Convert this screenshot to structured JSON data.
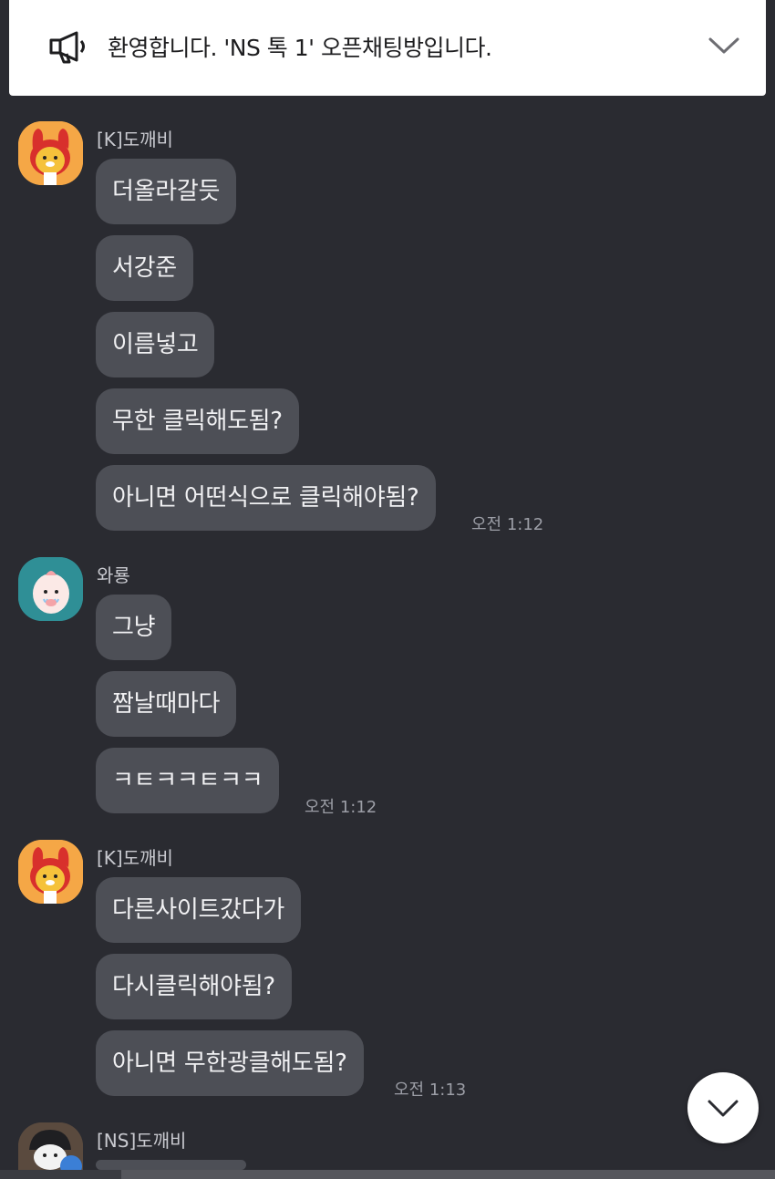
{
  "notice": {
    "text": "환영합니다. 'NS 톡 1' 오픈채팅방입니다.",
    "icon": "megaphone-icon",
    "toggle_icon": "chevron-down-icon"
  },
  "groups": [
    {
      "sender": "[K]도깨비",
      "avatar": "ryan-character-avatar",
      "messages": [
        "더올라갈듯",
        "서강준",
        "이름넣고",
        "무한 클릭해도됨?",
        "아니면 어떤식으로 클릭해야됨?"
      ],
      "time": "오전 1:12"
    },
    {
      "sender": "와룡",
      "avatar": "apeach-character-avatar",
      "messages": [
        "그냥",
        "짬날때마다",
        "ㅋㅌㅋㅋㅌㅋㅋ"
      ],
      "time": "오전 1:12"
    },
    {
      "sender": "[K]도깨비",
      "avatar": "ryan-character-avatar",
      "messages": [
        "다른사이트갔다가",
        "다시클릭해야됨?",
        "아니면 무한광클해도됨?"
      ],
      "time": "오전 1:13"
    },
    {
      "sender": "[NS]도깨비",
      "avatar": "neo-character-avatar",
      "messages": []
    }
  ],
  "colors": {
    "background": "#2a2b31",
    "bubble": "#4d4f56",
    "notice_bg": "#ffffff"
  },
  "scroll_button_icon": "chevron-down-icon"
}
